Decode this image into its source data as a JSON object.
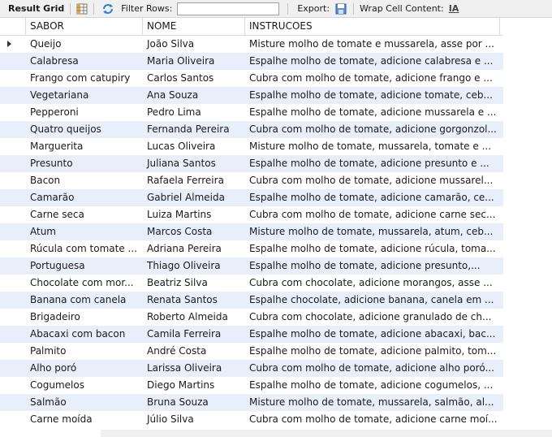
{
  "toolbar": {
    "result_grid_label": "Result Grid",
    "filter_label": "Filter Rows:",
    "filter_value": "",
    "export_label": "Export:",
    "wrap_label": "Wrap Cell Content:",
    "wrap_icon": "IA"
  },
  "columns": [
    "SABOR",
    "NOME",
    "INSTRUCOES"
  ],
  "rows": [
    [
      "Queijo",
      "João Silva",
      "Misture molho de tomate e mussarela, asse por ..."
    ],
    [
      "Calabresa",
      "Maria Oliveira",
      "Espalhe molho de tomate, adicione calabresa e ..."
    ],
    [
      "Frango com catupiry",
      "Carlos Santos",
      "Cubra com molho de tomate, adicione frango e ..."
    ],
    [
      "Vegetariana",
      "Ana Souza",
      "Espalhe molho de tomate, adicione tomate, ceb..."
    ],
    [
      "Pepperoni",
      "Pedro Lima",
      "Espalhe molho de tomate, adicione mussarela e ..."
    ],
    [
      "Quatro queijos",
      "Fernanda Pereira",
      "Cubra com molho de tomate, adicione gorgonzol..."
    ],
    [
      "Marguerita",
      "Lucas Oliveira",
      "Misture molho de tomate, mussarela, tomate e ..."
    ],
    [
      "Presunto",
      "Juliana Santos",
      "Espalhe molho de tomate, adicione presunto e ..."
    ],
    [
      "Bacon",
      "Rafaela Ferreira",
      "Cubra com molho de tomate, adicione mussarel..."
    ],
    [
      "Camarão",
      "Gabriel Almeida",
      "Espalhe molho de tomate, adicione camarão, ce..."
    ],
    [
      "Carne seca",
      "Luiza Martins",
      "Cubra com molho de tomate, adicione carne sec..."
    ],
    [
      "Atum",
      "Marcos Costa",
      "Misture molho de tomate, mussarela, atum, ceb..."
    ],
    [
      "Rúcula com tomate ...",
      "Adriana Pereira",
      "Espalhe molho de tomate, adicione rúcula, toma..."
    ],
    [
      "Portuguesa",
      "Thiago Oliveira",
      "Espalhe molho de tomate, adicione presunto,..."
    ],
    [
      "Chocolate com mor...",
      "Beatriz Silva",
      "Cubra com chocolate, adicione morangos, asse ..."
    ],
    [
      "Banana com canela",
      "Renata Santos",
      "Espalhe chocolate, adicione banana, canela em ..."
    ],
    [
      "Brigadeiro",
      "Roberto Almeida",
      "Cubra com chocolate, adicione granulado de ch..."
    ],
    [
      "Abacaxi com bacon",
      "Camila Ferreira",
      "Espalhe molho de tomate, adicione abacaxi, bac..."
    ],
    [
      "Palmito",
      "André Costa",
      "Espalhe molho de tomate, adicione palmito, tom..."
    ],
    [
      "Alho poró",
      "Larissa Oliveira",
      "Cubra com molho de tomate, adicione alho poró..."
    ],
    [
      "Cogumelos",
      "Diego Martins",
      "Espalhe molho de tomate, adicione cogumelos, ..."
    ],
    [
      "Salmão",
      "Bruna Souza",
      "Misture molho de tomate, mussarela, salmão, al..."
    ],
    [
      "Carne moída",
      "Júlio Silva",
      "Cubra com molho de tomate, adicione carne moí..."
    ]
  ],
  "selected_row": 0,
  "colors": {
    "alt_row": "#e9effa",
    "toolbar_bg": "#f0f0f0"
  }
}
